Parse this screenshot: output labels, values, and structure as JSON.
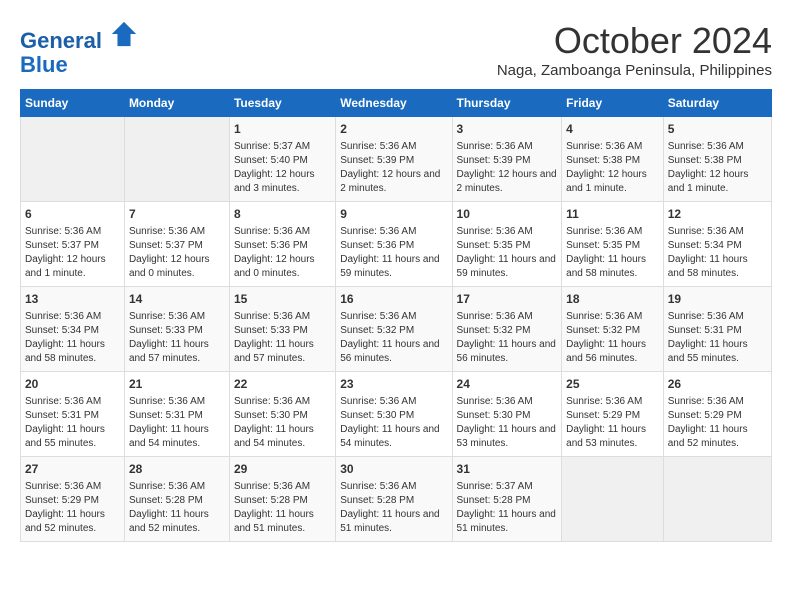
{
  "logo": {
    "line1": "General",
    "line2": "Blue"
  },
  "header": {
    "month": "October 2024",
    "location": "Naga, Zamboanga Peninsula, Philippines"
  },
  "days_of_week": [
    "Sunday",
    "Monday",
    "Tuesday",
    "Wednesday",
    "Thursday",
    "Friday",
    "Saturday"
  ],
  "weeks": [
    [
      {
        "day": "",
        "content": ""
      },
      {
        "day": "",
        "content": ""
      },
      {
        "day": "1",
        "content": "Sunrise: 5:37 AM\nSunset: 5:40 PM\nDaylight: 12 hours and 3 minutes."
      },
      {
        "day": "2",
        "content": "Sunrise: 5:36 AM\nSunset: 5:39 PM\nDaylight: 12 hours and 2 minutes."
      },
      {
        "day": "3",
        "content": "Sunrise: 5:36 AM\nSunset: 5:39 PM\nDaylight: 12 hours and 2 minutes."
      },
      {
        "day": "4",
        "content": "Sunrise: 5:36 AM\nSunset: 5:38 PM\nDaylight: 12 hours and 1 minute."
      },
      {
        "day": "5",
        "content": "Sunrise: 5:36 AM\nSunset: 5:38 PM\nDaylight: 12 hours and 1 minute."
      }
    ],
    [
      {
        "day": "6",
        "content": "Sunrise: 5:36 AM\nSunset: 5:37 PM\nDaylight: 12 hours and 1 minute."
      },
      {
        "day": "7",
        "content": "Sunrise: 5:36 AM\nSunset: 5:37 PM\nDaylight: 12 hours and 0 minutes."
      },
      {
        "day": "8",
        "content": "Sunrise: 5:36 AM\nSunset: 5:36 PM\nDaylight: 12 hours and 0 minutes."
      },
      {
        "day": "9",
        "content": "Sunrise: 5:36 AM\nSunset: 5:36 PM\nDaylight: 11 hours and 59 minutes."
      },
      {
        "day": "10",
        "content": "Sunrise: 5:36 AM\nSunset: 5:35 PM\nDaylight: 11 hours and 59 minutes."
      },
      {
        "day": "11",
        "content": "Sunrise: 5:36 AM\nSunset: 5:35 PM\nDaylight: 11 hours and 58 minutes."
      },
      {
        "day": "12",
        "content": "Sunrise: 5:36 AM\nSunset: 5:34 PM\nDaylight: 11 hours and 58 minutes."
      }
    ],
    [
      {
        "day": "13",
        "content": "Sunrise: 5:36 AM\nSunset: 5:34 PM\nDaylight: 11 hours and 58 minutes."
      },
      {
        "day": "14",
        "content": "Sunrise: 5:36 AM\nSunset: 5:33 PM\nDaylight: 11 hours and 57 minutes."
      },
      {
        "day": "15",
        "content": "Sunrise: 5:36 AM\nSunset: 5:33 PM\nDaylight: 11 hours and 57 minutes."
      },
      {
        "day": "16",
        "content": "Sunrise: 5:36 AM\nSunset: 5:32 PM\nDaylight: 11 hours and 56 minutes."
      },
      {
        "day": "17",
        "content": "Sunrise: 5:36 AM\nSunset: 5:32 PM\nDaylight: 11 hours and 56 minutes."
      },
      {
        "day": "18",
        "content": "Sunrise: 5:36 AM\nSunset: 5:32 PM\nDaylight: 11 hours and 56 minutes."
      },
      {
        "day": "19",
        "content": "Sunrise: 5:36 AM\nSunset: 5:31 PM\nDaylight: 11 hours and 55 minutes."
      }
    ],
    [
      {
        "day": "20",
        "content": "Sunrise: 5:36 AM\nSunset: 5:31 PM\nDaylight: 11 hours and 55 minutes."
      },
      {
        "day": "21",
        "content": "Sunrise: 5:36 AM\nSunset: 5:31 PM\nDaylight: 11 hours and 54 minutes."
      },
      {
        "day": "22",
        "content": "Sunrise: 5:36 AM\nSunset: 5:30 PM\nDaylight: 11 hours and 54 minutes."
      },
      {
        "day": "23",
        "content": "Sunrise: 5:36 AM\nSunset: 5:30 PM\nDaylight: 11 hours and 54 minutes."
      },
      {
        "day": "24",
        "content": "Sunrise: 5:36 AM\nSunset: 5:30 PM\nDaylight: 11 hours and 53 minutes."
      },
      {
        "day": "25",
        "content": "Sunrise: 5:36 AM\nSunset: 5:29 PM\nDaylight: 11 hours and 53 minutes."
      },
      {
        "day": "26",
        "content": "Sunrise: 5:36 AM\nSunset: 5:29 PM\nDaylight: 11 hours and 52 minutes."
      }
    ],
    [
      {
        "day": "27",
        "content": "Sunrise: 5:36 AM\nSunset: 5:29 PM\nDaylight: 11 hours and 52 minutes."
      },
      {
        "day": "28",
        "content": "Sunrise: 5:36 AM\nSunset: 5:28 PM\nDaylight: 11 hours and 52 minutes."
      },
      {
        "day": "29",
        "content": "Sunrise: 5:36 AM\nSunset: 5:28 PM\nDaylight: 11 hours and 51 minutes."
      },
      {
        "day": "30",
        "content": "Sunrise: 5:36 AM\nSunset: 5:28 PM\nDaylight: 11 hours and 51 minutes."
      },
      {
        "day": "31",
        "content": "Sunrise: 5:37 AM\nSunset: 5:28 PM\nDaylight: 11 hours and 51 minutes."
      },
      {
        "day": "",
        "content": ""
      },
      {
        "day": "",
        "content": ""
      }
    ]
  ]
}
